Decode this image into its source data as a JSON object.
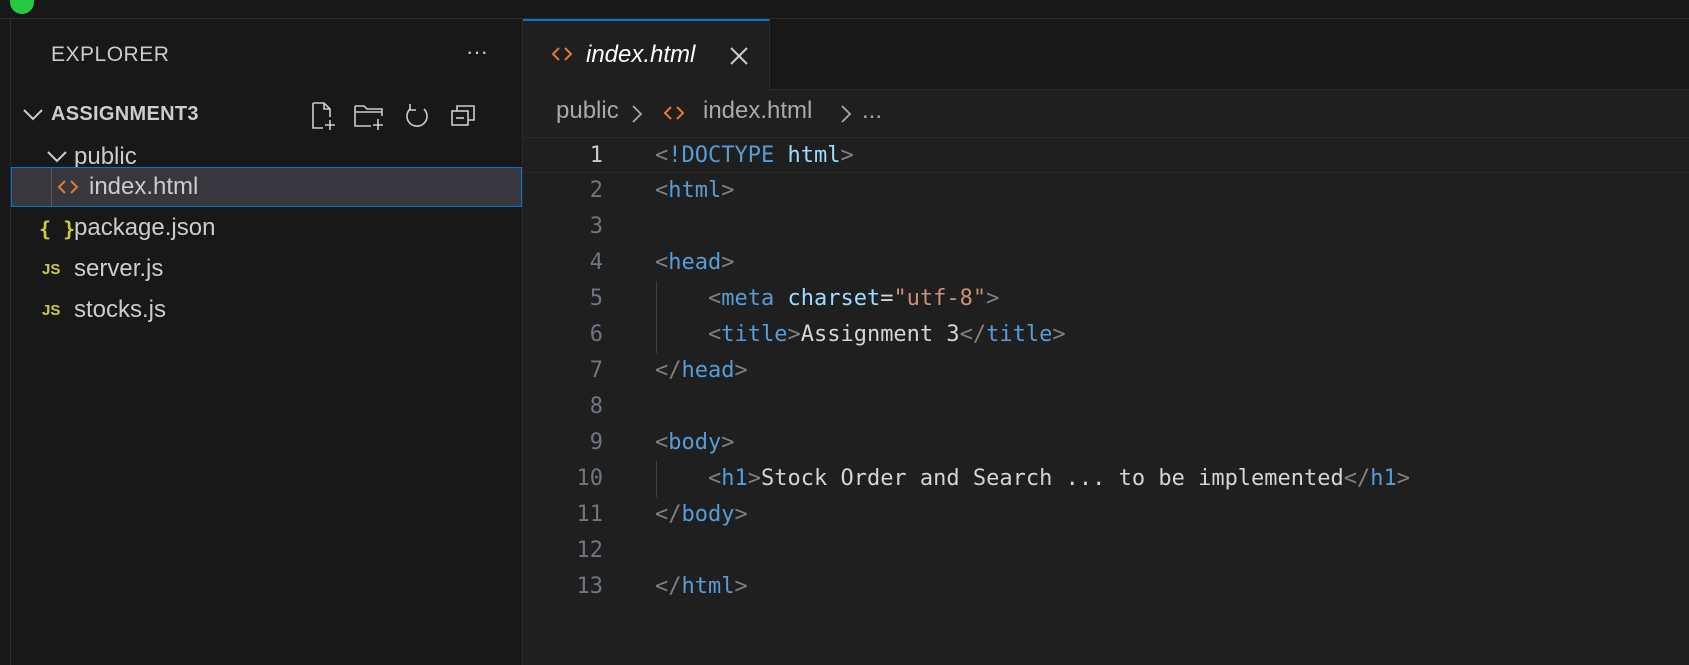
{
  "sidebar": {
    "title": "EXPLORER",
    "more_label": "···",
    "section": "ASSIGNMENT3",
    "tree": [
      {
        "label": "public",
        "kind": "folder"
      },
      {
        "label": "index.html",
        "kind": "html",
        "selected": true
      },
      {
        "label": "package.json",
        "kind": "json"
      },
      {
        "label": "server.js",
        "kind": "js"
      },
      {
        "label": "stocks.js",
        "kind": "js"
      }
    ],
    "json_glyph": "{ }",
    "js_glyph": "JS"
  },
  "editor": {
    "tab": {
      "label": "index.html"
    },
    "breadcrumb": [
      "public",
      "index.html",
      "..."
    ],
    "line_numbers": [
      "1",
      "2",
      "3",
      "4",
      "5",
      "6",
      "7",
      "8",
      "9",
      "10",
      "11",
      "12",
      "13"
    ],
    "lines": [
      "<!DOCTYPE html>",
      "<html>",
      "",
      "<head>",
      "    <meta charset=\"utf-8\">",
      "    <title>Assignment 3</title>",
      "</head>",
      "",
      "<body>",
      "    <h1>Stock Order and Search ... to be implemented</h1>",
      "</body>",
      "",
      "</html>"
    ]
  },
  "colors": {
    "accent": "#0078d4",
    "html_icon": "#e37933",
    "js_icon": "#cbcb41"
  }
}
